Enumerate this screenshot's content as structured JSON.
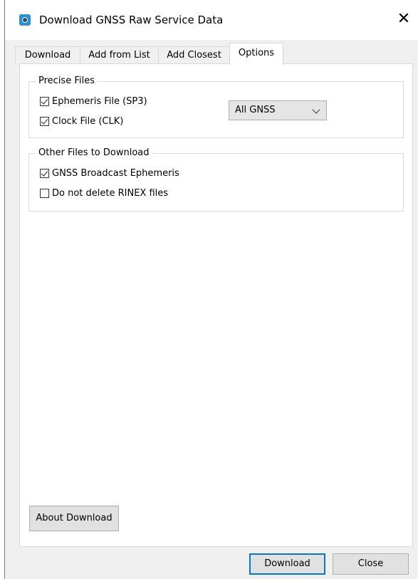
{
  "window": {
    "title": "Download GNSS Raw Service Data"
  },
  "tabs": [
    {
      "label": "Download",
      "active": false
    },
    {
      "label": "Add from List",
      "active": false
    },
    {
      "label": "Add Closest",
      "active": false
    },
    {
      "label": "Options",
      "active": true
    }
  ],
  "precise_files": {
    "legend": "Precise Files",
    "ephemeris": {
      "label": "Ephemeris File (SP3)",
      "checked": true
    },
    "clock": {
      "label": "Clock File (CLK)",
      "checked": true
    },
    "constellation": {
      "selected": "All GNSS"
    }
  },
  "other_files": {
    "legend": "Other Files to Download",
    "broadcast": {
      "label": "GNSS Broadcast Ephemeris",
      "checked": true
    },
    "keep_rinex": {
      "label": "Do not delete RINEX files",
      "checked": false
    }
  },
  "buttons": {
    "about": "About Download",
    "download": "Download",
    "close": "Close"
  },
  "colors": {
    "accent": "#0078d7",
    "app_icon": "#2b8fd6"
  },
  "icons": {
    "app": "gnss-app-icon",
    "close": "close-icon",
    "dropdown": "chevron-down-icon"
  }
}
